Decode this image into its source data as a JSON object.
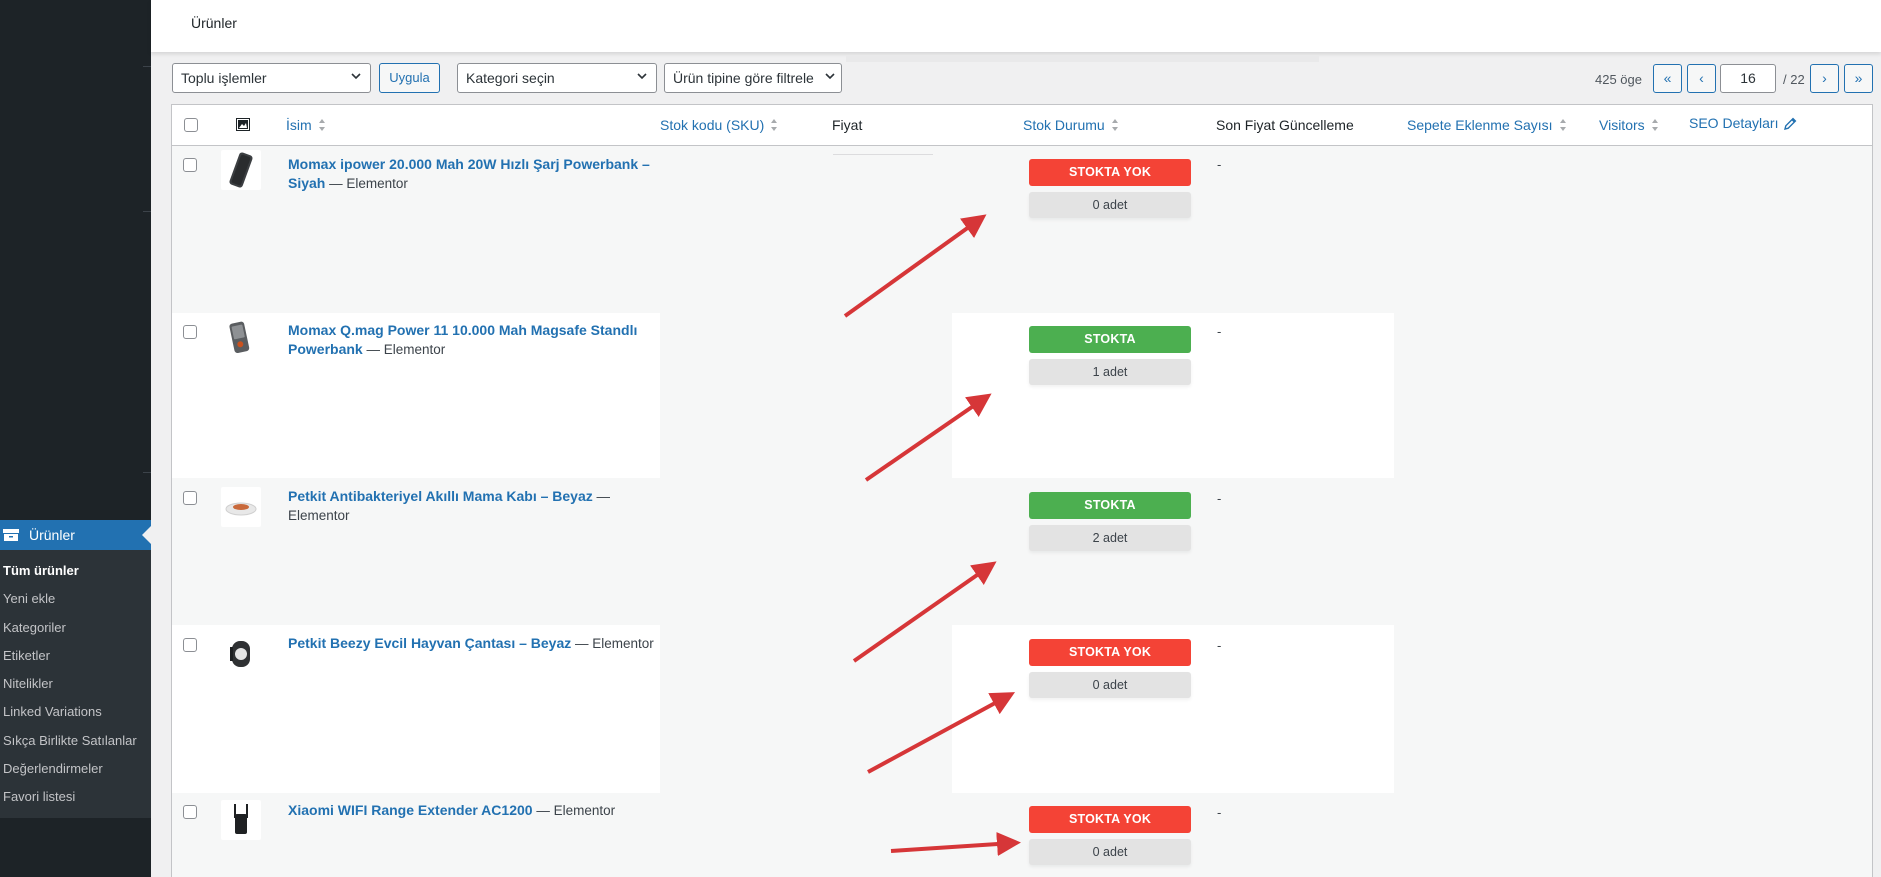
{
  "sidebar": {
    "menu_title": "Ürünler",
    "items": [
      {
        "label": "Tüm ürünler",
        "current": true
      },
      {
        "label": "Yeni ekle",
        "current": false
      },
      {
        "label": "Kategoriler",
        "current": false
      },
      {
        "label": "Etiketler",
        "current": false
      },
      {
        "label": "Nitelikler",
        "current": false
      },
      {
        "label": "Linked Variations",
        "current": false
      },
      {
        "label": "Sıkça Birlikte Satılanlar",
        "current": false
      },
      {
        "label": "Değerlendirmeler",
        "current": false
      },
      {
        "label": "Favori listesi",
        "current": false
      }
    ]
  },
  "header": {
    "title": "Ürünler"
  },
  "filters": {
    "bulk_actions": "Toplu işlemler",
    "apply": "Uygula",
    "category": "Kategori seçin",
    "product_type": "Ürün tipine göre filtrele"
  },
  "pagination": {
    "item_count": "425 öge",
    "first": "«",
    "prev": "‹",
    "current_page": "16",
    "total": "/ 22",
    "next": "›",
    "last": "»"
  },
  "columns": {
    "name": "İsim",
    "sku": "Stok kodu (SKU)",
    "price": "Fiyat",
    "stock": "Stok Durumu",
    "last_price_update": "Son Fiyat Güncelleme",
    "cart_adds": "Sepete Eklenme Sayısı",
    "visitors": "Visitors",
    "seo": "SEO Detayları"
  },
  "rows": [
    {
      "name": "Momax ipower 20.000 Mah 20W Hızlı Şarj Powerbank – Siyah",
      "suffix": " — Elementor",
      "stock_status": "STOKTA YOK",
      "stock_qty": "0 adet",
      "last_update": "-",
      "thumb_icon": "powerbank-icon"
    },
    {
      "name": "Momax Q.mag Power 11 10.000 Mah Magsafe Standlı Powerbank",
      "suffix": " — Elementor",
      "stock_status": "STOKTA",
      "stock_qty": "1 adet",
      "last_update": "-",
      "thumb_icon": "magsafe-powerbank-icon"
    },
    {
      "name": "Petkit Antibakteriyel Akıllı Mama Kabı – Beyaz",
      "suffix": " — Elementor",
      "stock_status": "STOKTA",
      "stock_qty": "2 adet",
      "last_update": "-",
      "thumb_icon": "pet-bowl-icon"
    },
    {
      "name": "Petkit Beezy Evcil Hayvan Çantası – Beyaz",
      "suffix": " — Elementor",
      "stock_status": "STOKTA YOK",
      "stock_qty": "0 adet",
      "last_update": "-",
      "thumb_icon": "pet-bag-icon"
    },
    {
      "name": "Xiaomi WIFI Range Extender AC1200",
      "suffix": " — Elementor",
      "stock_status": "STOKTA YOK",
      "stock_qty": "0 adet",
      "last_update": "-",
      "thumb_icon": "wifi-extender-icon"
    }
  ],
  "colors": {
    "out_of_stock": "#f44336",
    "in_stock": "#4caf50",
    "link": "#2271b1",
    "annotation_arrow": "#d63638"
  }
}
